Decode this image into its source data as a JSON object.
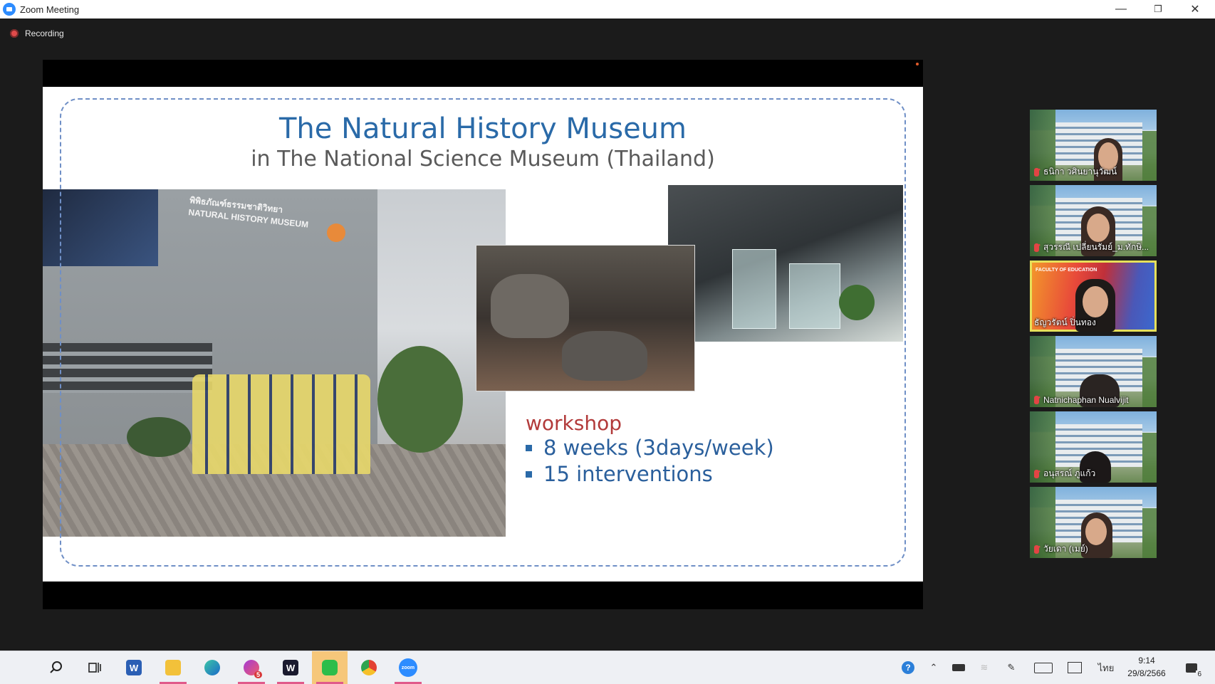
{
  "window": {
    "title": "Zoom Meeting",
    "minimize": "—",
    "restore": "❐",
    "close": "✕"
  },
  "recording": {
    "label": "Recording"
  },
  "slide": {
    "title": "The Natural History Museum",
    "subtitle": "in The National Science Museum (Thailand)",
    "sign_text": "พิพิธภัณฑ์ธรรมชาติวิทยา NATURAL HISTORY MUSEUM",
    "workshop_heading": "workshop",
    "bullets": [
      "8 weeks (3days/week)",
      "15 interventions"
    ]
  },
  "participants": [
    {
      "name": "ธนิกา วศินยานุวัฒน์",
      "muted": true,
      "active": false
    },
    {
      "name": "สุวรรณี เปลี่ยนรัมย์_ม.ทักษิ...",
      "muted": true,
      "active": false
    },
    {
      "name": "ธัญวรัตน์ ปิ่นทอง",
      "muted": false,
      "active": true,
      "banner": "FACULTY OF EDUCATION"
    },
    {
      "name": "Natnichaphan Nualvijit",
      "muted": true,
      "active": false
    },
    {
      "name": "อนุสรณ์ ภูแก้ว",
      "muted": true,
      "active": false
    },
    {
      "name": "วัยเดา (เมย์)",
      "muted": true,
      "active": false
    }
  ],
  "taskbar": {
    "apps": [
      "start-icon",
      "search-icon",
      "task-view-icon",
      "word-icon",
      "file-explorer-icon",
      "edge-icon",
      "messenger-icon",
      "webex-icon",
      "line-icon",
      "chrome-icon",
      "zoom-icon"
    ],
    "messenger_badge": "5",
    "language": "ไทย",
    "time": "9:14",
    "date": "29/8/2566",
    "notification_count": "6"
  },
  "colors": {
    "accent": "#2d8cff",
    "title_blue": "#2a6aa8",
    "workshop_red": "#b23a3a",
    "active_speaker": "#e6e05a"
  }
}
